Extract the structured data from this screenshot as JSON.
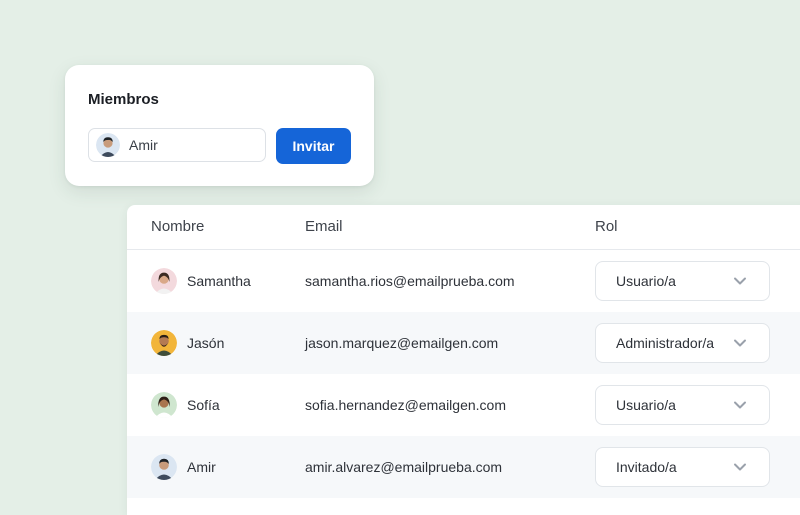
{
  "invite": {
    "title": "Miembros",
    "input_value": "Amir",
    "invite_label": "Invitar"
  },
  "table": {
    "headers": {
      "name": "Nombre",
      "email": "Email",
      "role": "Rol"
    },
    "rows": [
      {
        "name": "Samantha",
        "email": "samantha.rios@emailprueba.com",
        "role": "Usuario/a"
      },
      {
        "name": "Jasón",
        "email": "jason.marquez@emailgen.com",
        "role": "Administrador/a"
      },
      {
        "name": "Sofía",
        "email": "sofia.hernandez@emailgen.com",
        "role": "Usuario/a"
      },
      {
        "name": "Amir",
        "email": "amir.alvarez@emailprueba.com",
        "role": "Invitado/a"
      }
    ]
  },
  "colors": {
    "background": "#e4efe7",
    "accent": "#1565d8",
    "row_alt": "#f6f8fa"
  }
}
